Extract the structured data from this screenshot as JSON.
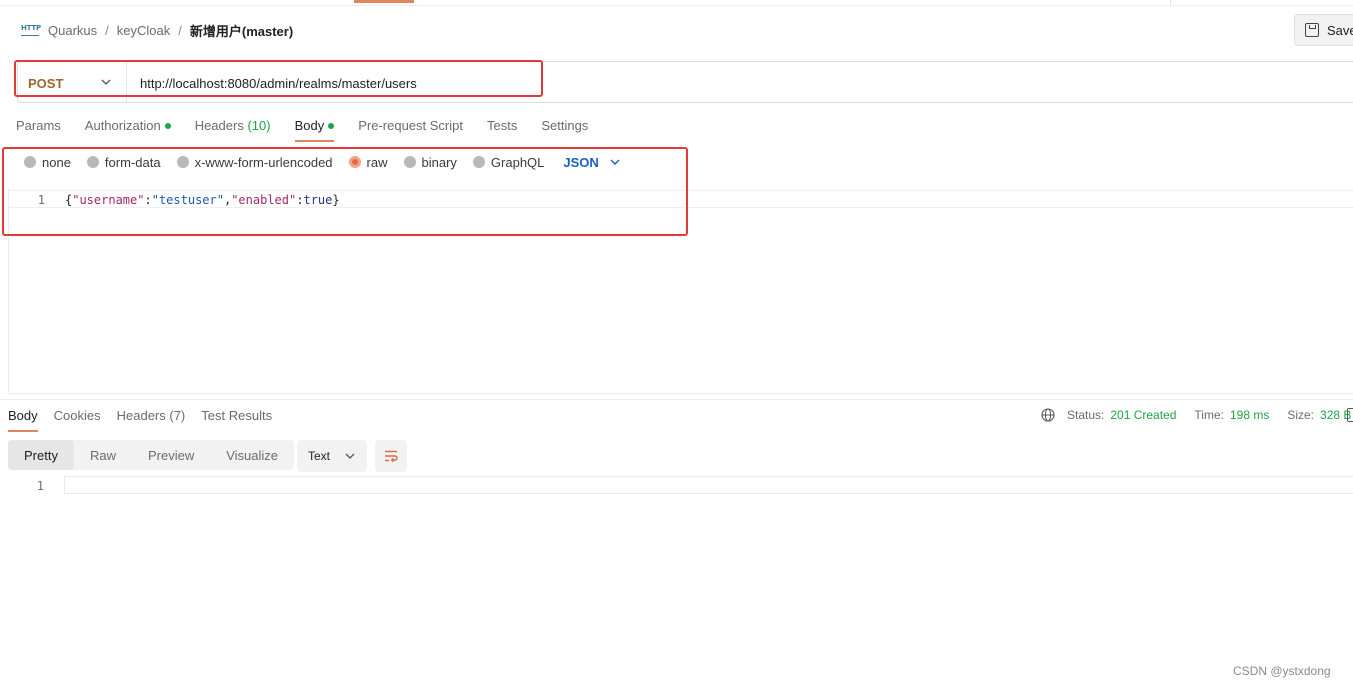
{
  "breadcrumb": {
    "icon_text": "HTTP",
    "items": [
      "Quarkus",
      "keyCloak"
    ],
    "separator": "/",
    "current": "新增用户(master)"
  },
  "toolbar": {
    "save_label": "Save"
  },
  "request": {
    "method": "POST",
    "url": "http://localhost:8080/admin/realms/master/users"
  },
  "request_tabs": [
    {
      "label": "Params"
    },
    {
      "label": "Authorization",
      "dot": true
    },
    {
      "label": "Headers",
      "count": "(10)"
    },
    {
      "label": "Body",
      "dot": true,
      "active": true
    },
    {
      "label": "Pre-request Script"
    },
    {
      "label": "Tests"
    },
    {
      "label": "Settings"
    }
  ],
  "body_types": {
    "options": [
      "none",
      "form-data",
      "x-www-form-urlencoded",
      "raw",
      "binary",
      "GraphQL"
    ],
    "selected": "raw",
    "language": "JSON"
  },
  "request_body": {
    "line_number": "1",
    "tokens": {
      "p1": "{",
      "k1": "\"username\"",
      "p2": ":",
      "v1": "\"testuser\"",
      "p3": ",",
      "k2": "\"enabled\"",
      "p4": ":",
      "v2": "true",
      "p5": "}"
    }
  },
  "response_tabs": [
    {
      "label": "Body",
      "active": true
    },
    {
      "label": "Cookies"
    },
    {
      "label": "Headers",
      "count": "(7)"
    },
    {
      "label": "Test Results"
    }
  ],
  "response_meta": {
    "status_label": "Status:",
    "status_value": "201 Created",
    "time_label": "Time:",
    "time_value": "198 ms",
    "size_label": "Size:",
    "size_value": "328 B"
  },
  "response_view": {
    "modes": [
      "Pretty",
      "Raw",
      "Preview",
      "Visualize"
    ],
    "active": "Pretty",
    "format": "Text"
  },
  "response_body": {
    "line_number": "1"
  },
  "watermark": "CSDN @ystxdong",
  "colors": {
    "accent": "#e0875d",
    "method_post": "#a0652a",
    "success": "#1ea446",
    "link_blue": "#1a5fc0",
    "highlight_red": "#e53935"
  }
}
